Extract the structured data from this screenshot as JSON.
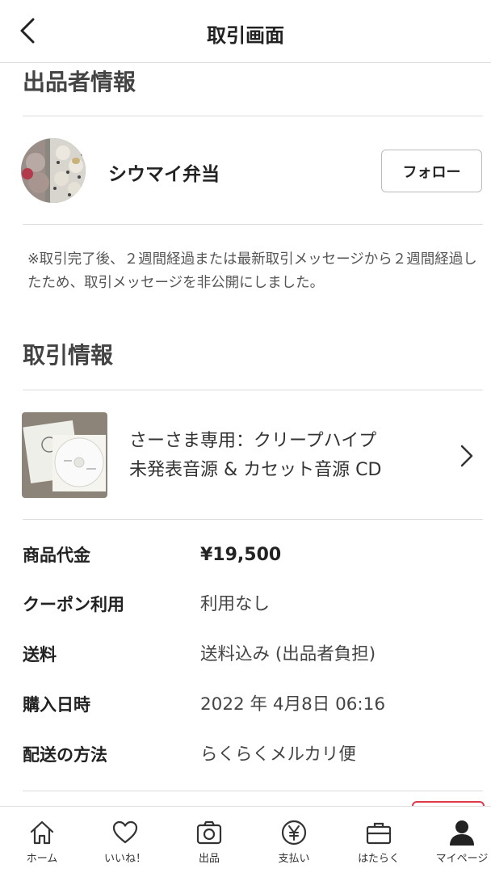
{
  "header": {
    "title": "取引画面"
  },
  "seller_section": {
    "title": "出品者情報",
    "name": "シウマイ弁当",
    "follow_label": "フォロー"
  },
  "notice": "※取引完了後、２週間経過または最新取引メッセージから２週間経過したため、取引メッセージを非公開にしました。",
  "transaction_section": {
    "title": "取引情報"
  },
  "item": {
    "title_line1": "さーさま専用：クリープハイプ",
    "title_line2": "未発表音源 & カセット音源 CD"
  },
  "details": [
    {
      "label": "商品代金",
      "value": "¥19,500"
    },
    {
      "label": "クーポン利用",
      "value": "利用なし"
    },
    {
      "label": "送料",
      "value": "送料込み (出品者負担)"
    },
    {
      "label": "購入日時",
      "value": "2022 年 4月8日 06:16"
    },
    {
      "label": "配送の方法",
      "value": "らくらくメルカリ便"
    }
  ],
  "tabs": [
    {
      "label": "ホーム",
      "icon": "home-icon"
    },
    {
      "label": "いいね！",
      "icon": "heart-icon"
    },
    {
      "label": "出品",
      "icon": "camera-icon"
    },
    {
      "label": "支払い",
      "icon": "yen-icon"
    },
    {
      "label": "はたらく",
      "icon": "briefcase-icon"
    },
    {
      "label": "マイページ",
      "icon": "user-icon"
    }
  ],
  "colors": {
    "accent_red": "#e0394a",
    "divider": "#dcdcdc",
    "text": "#333333"
  }
}
